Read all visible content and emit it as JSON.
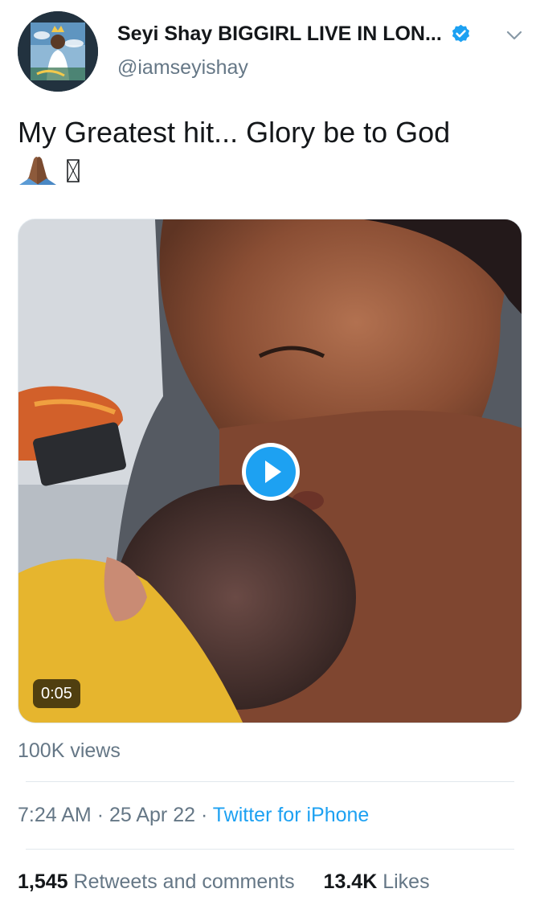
{
  "author": {
    "display_name": "Seyi Shay BIGGIRL LIVE IN LON...",
    "handle": "@iamseyishay",
    "verified": true,
    "avatar_icon": "album-cover-avatar"
  },
  "tweet": {
    "text": "My Greatest hit... Glory be to God",
    "emoji_icons": [
      "folded-hands-emoji",
      "missing-glyph-box"
    ]
  },
  "media": {
    "type": "video",
    "duration": "0:05",
    "play_icon": "play-icon"
  },
  "views": "100K views",
  "meta": {
    "time": "7:24 AM",
    "separator": "·",
    "date": "25 Apr 22",
    "source": "Twitter for iPhone"
  },
  "stats": {
    "retweets_count": "1,545",
    "retweets_label": "Retweets and comments",
    "likes_count": "13.4K",
    "likes_label": "Likes"
  },
  "colors": {
    "accent": "#1da1f2",
    "secondary_text": "#657786",
    "primary_text": "#14171a",
    "divider": "#e1e8ed"
  }
}
